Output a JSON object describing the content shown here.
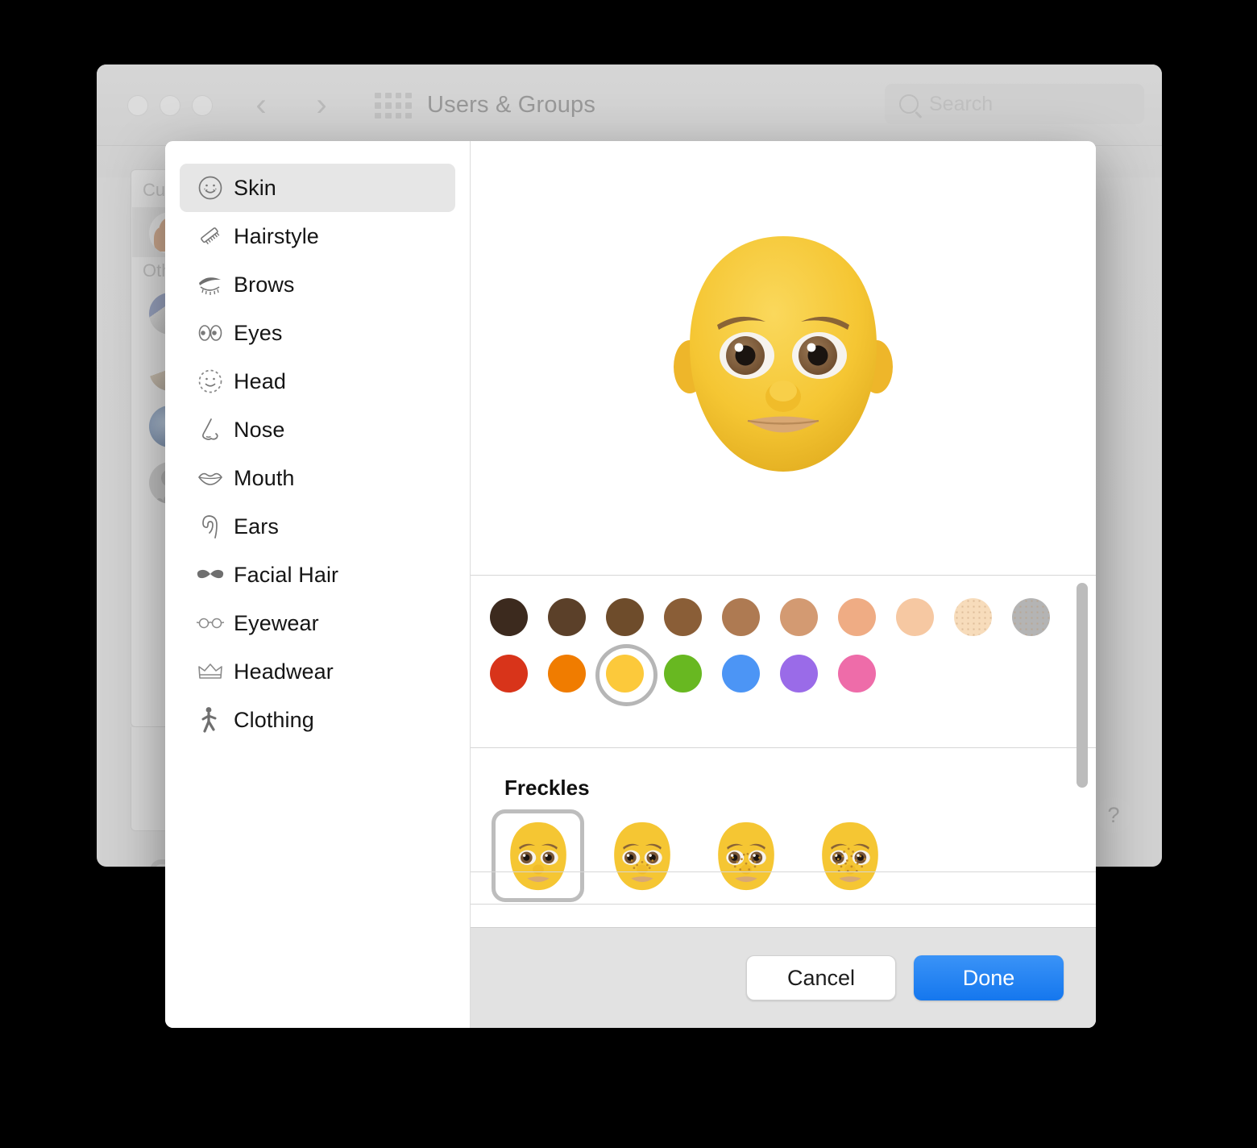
{
  "window": {
    "title": "Users & Groups",
    "search_placeholder": "Search",
    "nav_back_icon": "chevron-left-icon",
    "nav_forward_icon": "chevron-right-icon",
    "grid_icon": "grid-apps-icon",
    "search_icon": "search-icon",
    "help_label": "?",
    "add_label": "+",
    "groups": {
      "current_user": "Cu",
      "others": "Oth"
    }
  },
  "dialog": {
    "sidebar": {
      "items": [
        {
          "label": "Skin",
          "icon": "smiley-freckles-icon",
          "selected": true
        },
        {
          "label": "Hairstyle",
          "icon": "comb-icon",
          "selected": false
        },
        {
          "label": "Brows",
          "icon": "eyebrow-icon",
          "selected": false
        },
        {
          "label": "Eyes",
          "icon": "eyes-icon",
          "selected": false
        },
        {
          "label": "Head",
          "icon": "dashed-face-icon",
          "selected": false
        },
        {
          "label": "Nose",
          "icon": "nose-icon",
          "selected": false
        },
        {
          "label": "Mouth",
          "icon": "lips-icon",
          "selected": false
        },
        {
          "label": "Ears",
          "icon": "ear-icon",
          "selected": false
        },
        {
          "label": "Facial Hair",
          "icon": "mustache-icon",
          "selected": false
        },
        {
          "label": "Eyewear",
          "icon": "glasses-icon",
          "selected": false
        },
        {
          "label": "Headwear",
          "icon": "crown-icon",
          "selected": false
        },
        {
          "label": "Clothing",
          "icon": "walking-person-icon",
          "selected": false
        }
      ]
    },
    "preview": {
      "alt": "memoji-face-preview",
      "skin_color": "#F5C33B"
    },
    "skin_tones": {
      "row1": [
        {
          "name": "tone-1",
          "color": "#3C2A1E",
          "selected": false,
          "textured": false
        },
        {
          "name": "tone-2",
          "color": "#5B4029",
          "selected": false,
          "textured": false
        },
        {
          "name": "tone-3",
          "color": "#6E4C2B",
          "selected": false,
          "textured": false
        },
        {
          "name": "tone-4",
          "color": "#8A5E37",
          "selected": false,
          "textured": false
        },
        {
          "name": "tone-5",
          "color": "#AE7A52",
          "selected": false,
          "textured": false
        },
        {
          "name": "tone-6",
          "color": "#D39A72",
          "selected": false,
          "textured": false
        },
        {
          "name": "tone-7",
          "color": "#EFAC84",
          "selected": false,
          "textured": false
        },
        {
          "name": "tone-8",
          "color": "#F6C8A2",
          "selected": false,
          "textured": false
        },
        {
          "name": "tone-9",
          "color": "#F7DCBB",
          "selected": false,
          "textured": true
        },
        {
          "name": "tone-10",
          "color": "#B4B4B4",
          "selected": false,
          "textured": true
        }
      ],
      "row2": [
        {
          "name": "color-red",
          "color": "#D8341A",
          "selected": false,
          "textured": false
        },
        {
          "name": "color-orange",
          "color": "#F07C00",
          "selected": false,
          "textured": false
        },
        {
          "name": "color-yellow",
          "color": "#FCC93B",
          "selected": true,
          "textured": false
        },
        {
          "name": "color-green",
          "color": "#68B821",
          "selected": false,
          "textured": false
        },
        {
          "name": "color-blue",
          "color": "#4C95F5",
          "selected": false,
          "textured": false
        },
        {
          "name": "color-purple",
          "color": "#9A6BE8",
          "selected": false,
          "textured": false
        },
        {
          "name": "color-pink",
          "color": "#EE6CA9",
          "selected": false,
          "textured": false
        }
      ],
      "selection_ring_color": "#B6B6B6"
    },
    "freckles": {
      "title": "Freckles",
      "options": [
        {
          "name": "freckles-none",
          "density": 0,
          "selected": true
        },
        {
          "name": "freckles-light",
          "density": 1,
          "selected": false
        },
        {
          "name": "freckles-medium",
          "density": 2,
          "selected": false
        },
        {
          "name": "freckles-heavy",
          "density": 3,
          "selected": false
        }
      ]
    },
    "footer": {
      "cancel_label": "Cancel",
      "done_label": "Done",
      "done_color": "#1577EE"
    },
    "scrollbar": {
      "name": "content-scrollbar"
    }
  }
}
